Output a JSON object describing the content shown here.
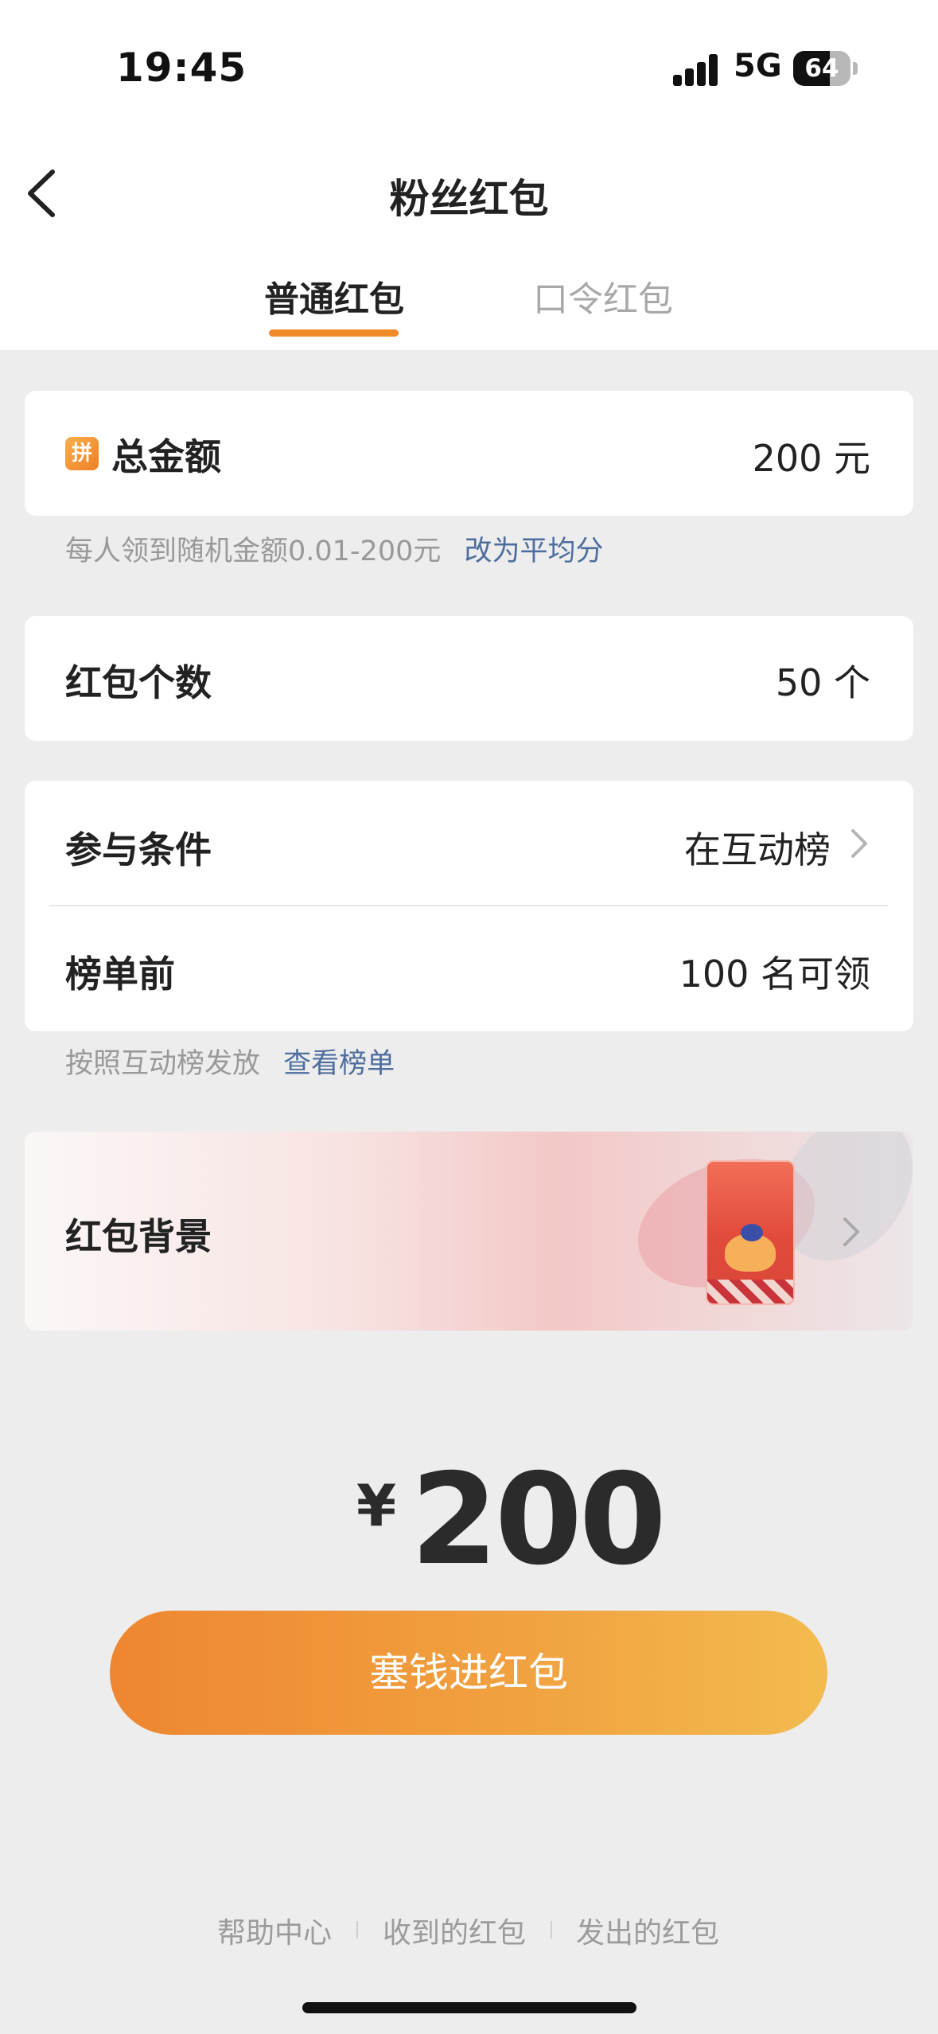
{
  "status_bar": {
    "time": "19:45",
    "network": "5G",
    "battery": "64",
    "battery_level_percent": 64
  },
  "header": {
    "title": "粉丝红包",
    "back_icon": "chevron-left-icon"
  },
  "tabs": [
    {
      "label": "普通红包",
      "active": true
    },
    {
      "label": "口令红包",
      "active": false
    }
  ],
  "total_amount": {
    "icon_text": "拼",
    "label": "总金额",
    "value": "200 元"
  },
  "amount_hint": {
    "text": "每人领到随机金额0.01-200元",
    "link": "改为平均分"
  },
  "count": {
    "label": "红包个数",
    "value": "50 个"
  },
  "condition": {
    "label": "参与条件",
    "value": "在互动榜"
  },
  "rank": {
    "label": "榜单前",
    "value": "100 名可领"
  },
  "rank_hint": {
    "text": "按照互动榜发放",
    "link": "查看榜单"
  },
  "background": {
    "label": "红包背景"
  },
  "summary": {
    "currency": "¥",
    "amount": "200"
  },
  "submit_label": "塞钱进红包",
  "footer": {
    "help": "帮助中心",
    "received": "收到的红包",
    "sent": "发出的红包"
  },
  "colors": {
    "accent": "#F08A2A",
    "link": "#4E6E9E",
    "button_start": "#EE8630",
    "button_end": "#F3BB4F"
  }
}
